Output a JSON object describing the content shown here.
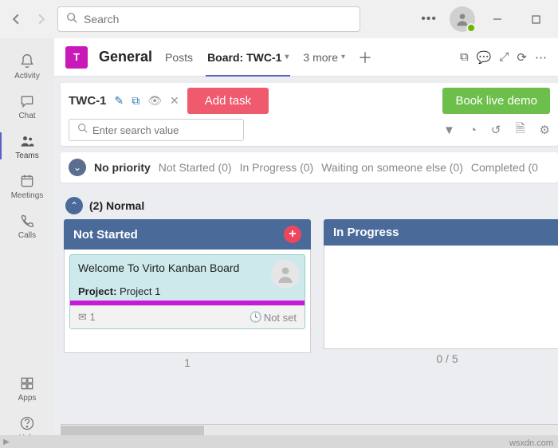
{
  "titlebar": {
    "search_placeholder": "Search"
  },
  "sidebar": {
    "items": [
      {
        "label": "Activity"
      },
      {
        "label": "Chat"
      },
      {
        "label": "Teams"
      },
      {
        "label": "Meetings"
      },
      {
        "label": "Calls"
      },
      {
        "label": "Apps"
      },
      {
        "label": "Help"
      }
    ]
  },
  "channel": {
    "avatar_letter": "T",
    "name": "General",
    "tabs": {
      "posts": "Posts",
      "board": "Board: TWC-1",
      "more": "3 more"
    }
  },
  "board": {
    "name": "TWC-1",
    "add_task": "Add task",
    "book_demo": "Book live demo",
    "search_placeholder": "Enter search value",
    "lane_nopriority": {
      "title": "No priority",
      "columns": [
        "Not Started (0)",
        "In Progress (0)",
        "Waiting on someone else (0)",
        "Completed (0"
      ]
    },
    "lane_normal": {
      "title": "(2) Normal",
      "columns": {
        "not_started": {
          "title": "Not Started",
          "count": "1",
          "card": {
            "title": "Welcome To Virto Kanban Board",
            "project_label": "Project:",
            "project_value": "Project 1",
            "comments": "1",
            "due": "Not set"
          }
        },
        "in_progress": {
          "title": "In Progress",
          "count": "0  /  5"
        }
      }
    }
  },
  "watermark": "wsxdn.com"
}
